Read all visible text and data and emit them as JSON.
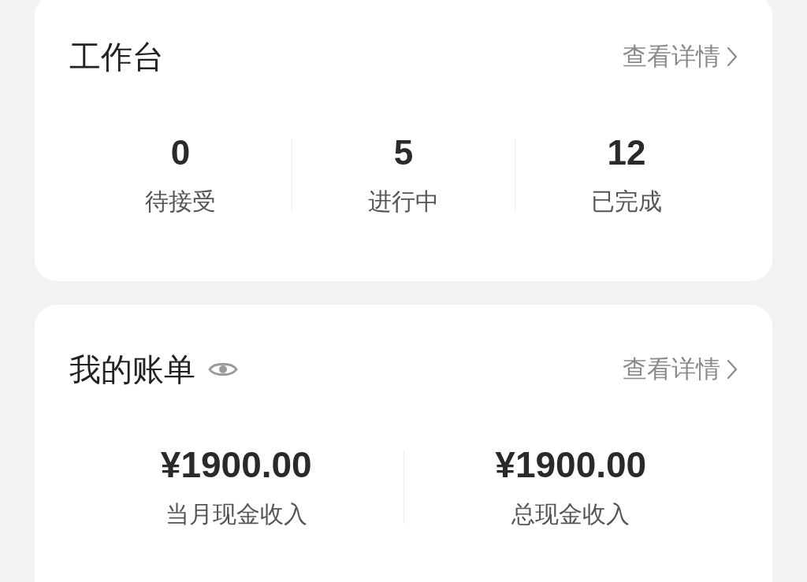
{
  "workbench": {
    "title": "工作台",
    "details_link": "查看详情",
    "stats": [
      {
        "value": "0",
        "label": "待接受"
      },
      {
        "value": "5",
        "label": "进行中"
      },
      {
        "value": "12",
        "label": "已完成"
      }
    ]
  },
  "bill": {
    "title": "我的账单",
    "details_link": "查看详情",
    "stats": [
      {
        "value": "¥1900.00",
        "label": "当月现金收入"
      },
      {
        "value": "¥1900.00",
        "label": "总现金收入"
      }
    ]
  }
}
